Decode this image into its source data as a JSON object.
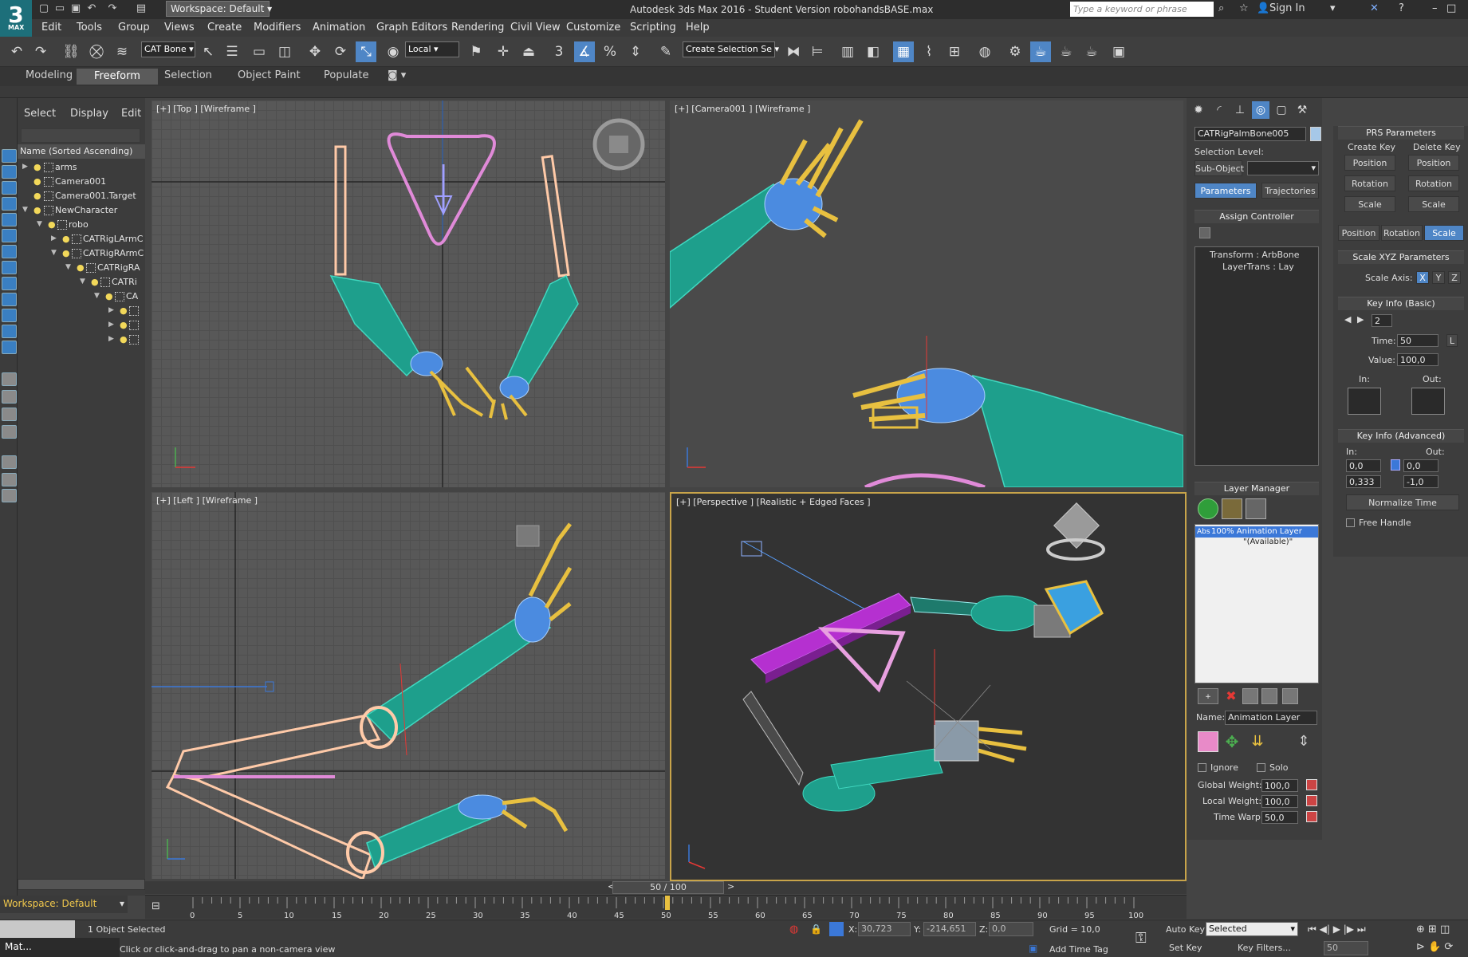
{
  "window": {
    "title": "Autodesk 3ds Max 2016 - Student Version    robohandsBASE.max",
    "workspace": "Workspace: Default",
    "search_placeholder": "Type a keyword or phrase",
    "sign_in": "Sign In",
    "logo_label": "MAX"
  },
  "menu": [
    "Edit",
    "Tools",
    "Group",
    "Views",
    "Create",
    "Modifiers",
    "Animation",
    "Graph Editors",
    "Rendering",
    "Civil View",
    "Customize",
    "Scripting",
    "Help"
  ],
  "toolbar": {
    "selection_filter": "CAT Bone",
    "coord_system": "Local",
    "selection_set": "Create Selection Se"
  },
  "ribbon": {
    "tabs": [
      "Modeling",
      "Freeform",
      "Selection",
      "Object Paint",
      "Populate"
    ],
    "active": "Freeform"
  },
  "explorer": {
    "tabs": [
      "Select",
      "Display",
      "Edit"
    ],
    "column": "Name (Sorted Ascending)",
    "items": [
      {
        "label": "arms"
      },
      {
        "label": "Camera001"
      },
      {
        "label": "Camera001.Target"
      },
      {
        "label": "NewCharacter"
      },
      {
        "label": "robo"
      },
      {
        "label": "CATRigLArmC"
      },
      {
        "label": "CATRigRArmC"
      },
      {
        "label": "CATRigRA"
      },
      {
        "label": "CATRi"
      },
      {
        "label": "CA"
      }
    ],
    "workspace": "Workspace: Default"
  },
  "viewports": {
    "top": "[+] [Top ] [Wireframe ]",
    "camera": "[+] [Camera001 ] [Wireframe ]",
    "left": "[+] [Left ] [Wireframe ]",
    "perspective": "[+] [Perspective ] [Realistic + Edged Faces ]"
  },
  "command_panel": {
    "object_name": "CATRigPalmBone005",
    "selection_level_label": "Selection Level:",
    "sub_object": "Sub-Object",
    "tab_parameters": "Parameters",
    "tab_trajectories": "Trajectories",
    "assign_controller": "Assign Controller",
    "controllers": [
      "Transform : ArbBone",
      "LayerTrans : Lay"
    ],
    "layer_manager": "Layer Manager",
    "layers": [
      "100% Animation Layer",
      "\"(Available)\""
    ],
    "layer_prefix": "Abs",
    "name_label": "Name:",
    "name_value": "Animation Layer",
    "ignore": "Ignore",
    "solo": "Solo",
    "global_weight_label": "Global Weight:",
    "global_weight": "100,0",
    "local_weight_label": "Local Weight:",
    "local_weight": "100,0",
    "time_warp_label": "Time Warp:",
    "time_warp": "50,0"
  },
  "prs": {
    "title": "PRS Parameters",
    "create_key": "Create Key",
    "delete_key": "Delete Key",
    "position": "Position",
    "rotation": "Rotation",
    "scale": "Scale",
    "scale_xyz": "Scale XYZ Parameters",
    "scale_axis_label": "Scale Axis:",
    "axes": [
      "X",
      "Y",
      "Z"
    ],
    "key_basic": "Key Info (Basic)",
    "key_index": "2",
    "time_label": "Time:",
    "time_value": "50",
    "lock": "L",
    "value_label": "Value:",
    "value": "100,0",
    "in_label": "In:",
    "out_label": "Out:",
    "key_advanced": "Key Info (Advanced)",
    "adv_in": "0,0",
    "adv_out": "0,0",
    "adv_in2": "0,333",
    "adv_out2": "-1,0",
    "normalize_time": "Normalize Time",
    "free_handle": "Free Handle"
  },
  "timeline": {
    "frame_display": "50 / 100",
    "ticks": [
      "0",
      "5",
      "10",
      "15",
      "20",
      "25",
      "30",
      "35",
      "40",
      "45",
      "50",
      "55",
      "60",
      "65",
      "70",
      "75",
      "80",
      "85",
      "90",
      "95",
      "100"
    ]
  },
  "status": {
    "selected": "1 Object Selected",
    "hint": "Click or click-and-drag to pan a non-camera view",
    "x_label": "X:",
    "x": "30,723",
    "y_label": "Y:",
    "y": "-214,651",
    "z_label": "Z:",
    "z": "0,0",
    "grid": "Grid = 10,0",
    "add_time_tag": "Add Time Tag",
    "auto_key": "Auto Key",
    "set_key": "Set Key",
    "selected_dd": "Selected",
    "key_filters": "Key Filters...",
    "frame": "50",
    "taskbar": "Mat..."
  },
  "colors": {
    "accent": "#4f86c6",
    "viewport_active": "#c8a44a",
    "workspace_text": "#f2c94c"
  }
}
